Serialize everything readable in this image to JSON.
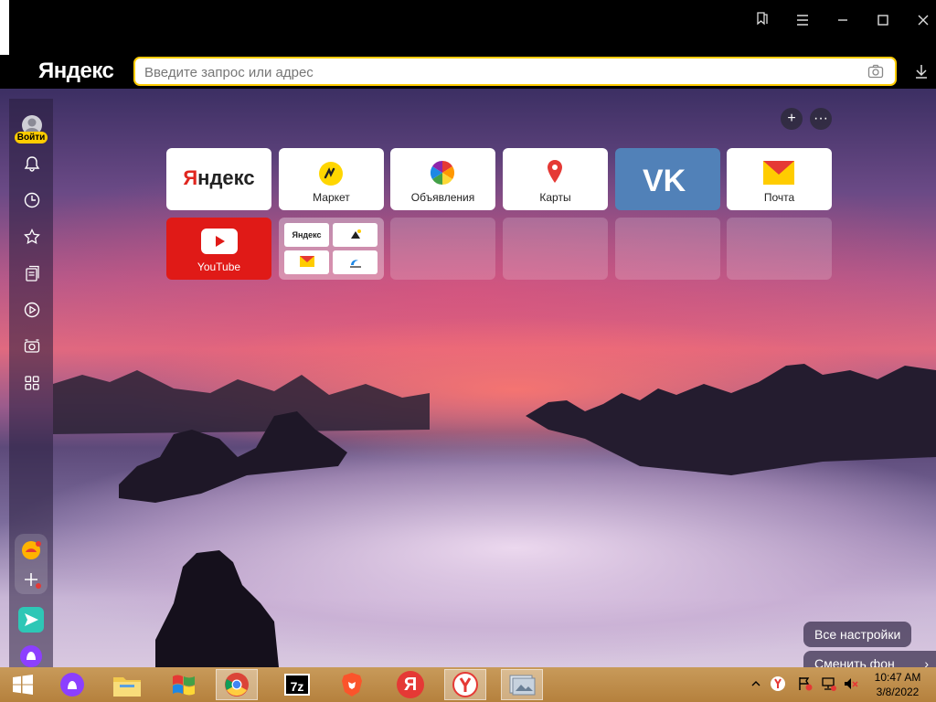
{
  "browser": {
    "logo": "Яндекс",
    "address_placeholder": "Введите запрос или адрес",
    "login_badge": "Войти"
  },
  "tiles": [
    {
      "label": "",
      "logo": "Яндекс"
    },
    {
      "label": "Маркет"
    },
    {
      "label": "Объявления"
    },
    {
      "label": "Карты"
    },
    {
      "label": ""
    },
    {
      "label": "Почта"
    },
    {
      "label": "YouTube"
    },
    {
      "label": ""
    },
    {
      "label": ""
    },
    {
      "label": ""
    },
    {
      "label": ""
    },
    {
      "label": ""
    }
  ],
  "group_tile": {
    "mini_logo": "Яндекс"
  },
  "bottom": {
    "all_settings": "Все настройки",
    "change_bg": "Сменить фон"
  },
  "taskbar": {
    "time": "10:47 AM",
    "date": "3/8/2022",
    "sevenzip": "7z",
    "yandex_letter": "Я"
  },
  "colors": {
    "accent": "#ffcc00",
    "vk": "#5181b8",
    "youtube": "#e01a17"
  }
}
